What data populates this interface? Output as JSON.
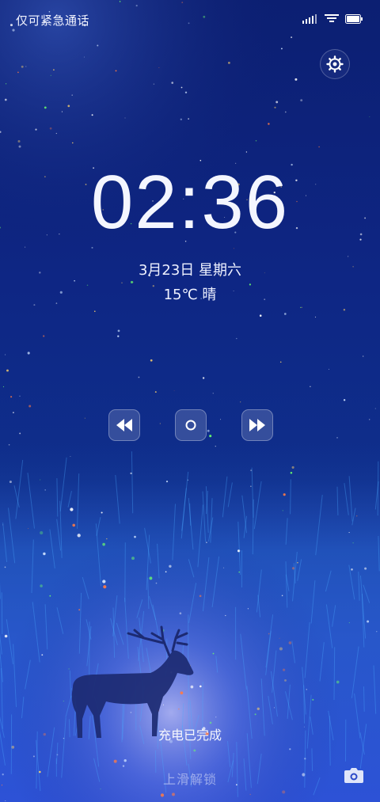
{
  "status_bar": {
    "carrier_text": "仅可紧急通话",
    "icons": [
      "signal-icon",
      "wifi-icon",
      "battery-icon"
    ]
  },
  "lock_screen": {
    "time": "02:36",
    "date": "3月23日 星期六",
    "weather": "15℃ 晴",
    "charging_status": "充电已完成",
    "unlock_hint": "上滑解锁"
  },
  "media_controls": {
    "buttons": [
      "previous-track",
      "play-pause",
      "next-track"
    ]
  },
  "shortcuts": {
    "top_right": "settings-gear-icon",
    "bottom_right": "camera-icon"
  },
  "colors": {
    "sky_top": "#0a1b6e",
    "sky_mid": "#12308f",
    "grass": "#1c55c4",
    "glow": "#8f9cf0"
  }
}
